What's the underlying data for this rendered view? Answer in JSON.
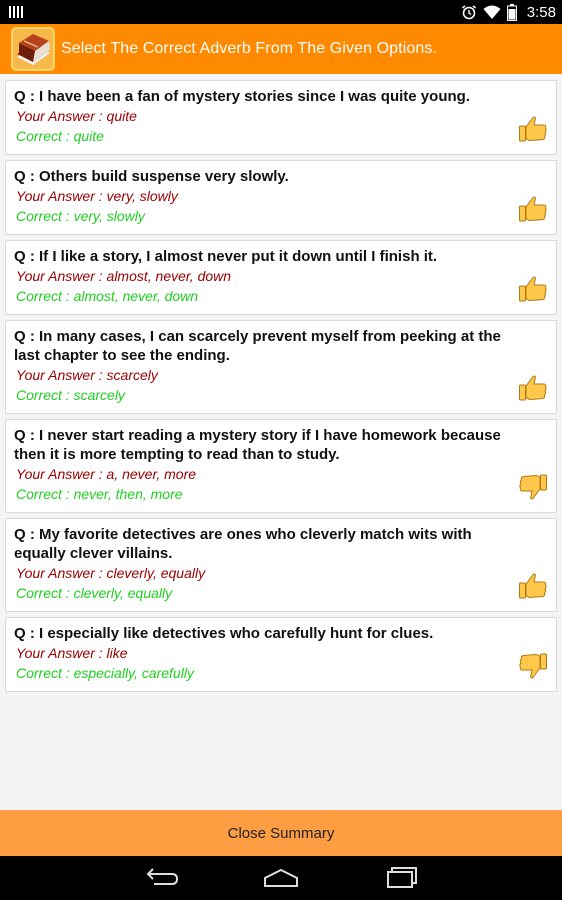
{
  "status_bar": {
    "time": "3:58"
  },
  "header": {
    "title": "Select The Correct Adverb From The Given Options."
  },
  "answer_prefix": "Your Answer : ",
  "correct_prefix": "Correct :  ",
  "questions": [
    {
      "q": "Q : I have been a fan of mystery stories since I was quite young.",
      "your_answer": "quite",
      "correct": "quite",
      "result": "thumbs-up"
    },
    {
      "q": "Q :  Others build suspense very slowly.",
      "your_answer": "very, slowly",
      "correct": "very, slowly",
      "result": "thumbs-up"
    },
    {
      "q": "Q : If I like a story, I almost never put it down until I finish it.",
      "your_answer": "almost, never, down",
      "correct": "almost, never, down",
      "result": "thumbs-up"
    },
    {
      "q": "Q :  In many cases, I can scarcely prevent myself from peeking at the last chapter to see the ending.",
      "your_answer": "scarcely",
      "correct": "scarcely",
      "result": "thumbs-up"
    },
    {
      "q": "Q :  I never start reading a mystery story if I have homework because then it is more tempting to read than to study.",
      "your_answer": "a, never, more",
      "correct": "never, then, more",
      "result": "thumbs-down"
    },
    {
      "q": "Q :  My favorite detectives are ones who cleverly match wits with equally clever villains.",
      "your_answer": "cleverly, equally",
      "correct": "cleverly, equally",
      "result": "thumbs-up"
    },
    {
      "q": "Q :  I especially like detectives who carefully hunt for clues.",
      "your_answer": "like",
      "correct": "especially, carefully",
      "result": "thumbs-down"
    }
  ],
  "close_button": {
    "label": "Close Summary"
  },
  "colors": {
    "header": "#ff8a00",
    "close_bar": "#fe9d41",
    "your_answer": "#9a0000",
    "correct": "#1fcf1f",
    "thumb": "#ffc84a"
  }
}
